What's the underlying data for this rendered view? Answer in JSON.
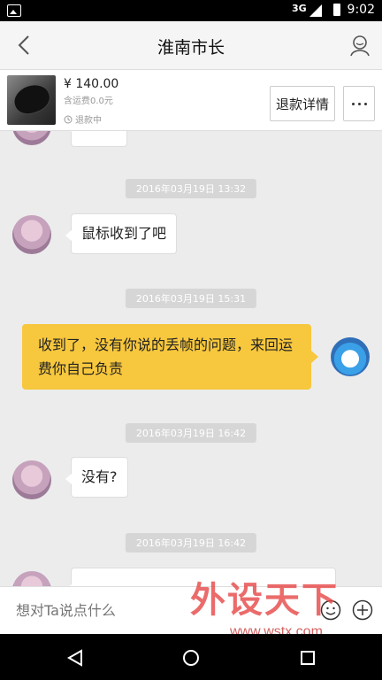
{
  "status_bar": {
    "network": "3G",
    "time": "9:02"
  },
  "header": {
    "title": "淮南市长"
  },
  "product": {
    "price": "¥ 140.00",
    "shipping": "含运费0.0元",
    "status": "退款中",
    "refund_button": "退款详情"
  },
  "messages": [
    {
      "timestamp": "2016年03月19日 13:32",
      "side": "left",
      "text": "鼠标收到了吧"
    },
    {
      "timestamp": "2016年03月19日 15:31",
      "side": "right",
      "text": "收到了，没有你说的丢帧的问题，来回运费你自己负责"
    },
    {
      "timestamp": "2016年03月19日 16:42",
      "side": "left",
      "text": "没有?"
    },
    {
      "timestamp": "2016年03月19日 16:42"
    }
  ],
  "input": {
    "placeholder": "想对Ta说点什么"
  },
  "watermark": {
    "logo_text": "外设天下",
    "url": "www.wstx.com"
  },
  "colors": {
    "accent": "#f7c73d",
    "background": "#ececec"
  }
}
